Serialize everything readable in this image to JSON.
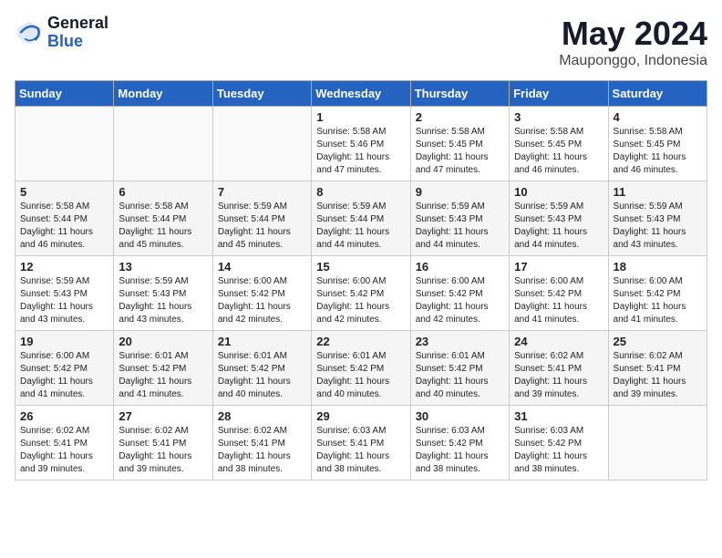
{
  "header": {
    "logo_general": "General",
    "logo_blue": "Blue",
    "month_year": "May 2024",
    "location": "Mauponggo, Indonesia"
  },
  "weekdays": [
    "Sunday",
    "Monday",
    "Tuesday",
    "Wednesday",
    "Thursday",
    "Friday",
    "Saturday"
  ],
  "weeks": [
    [
      {
        "day": "",
        "info": ""
      },
      {
        "day": "",
        "info": ""
      },
      {
        "day": "",
        "info": ""
      },
      {
        "day": "1",
        "info": "Sunrise: 5:58 AM\nSunset: 5:46 PM\nDaylight: 11 hours\nand 47 minutes."
      },
      {
        "day": "2",
        "info": "Sunrise: 5:58 AM\nSunset: 5:45 PM\nDaylight: 11 hours\nand 47 minutes."
      },
      {
        "day": "3",
        "info": "Sunrise: 5:58 AM\nSunset: 5:45 PM\nDaylight: 11 hours\nand 46 minutes."
      },
      {
        "day": "4",
        "info": "Sunrise: 5:58 AM\nSunset: 5:45 PM\nDaylight: 11 hours\nand 46 minutes."
      }
    ],
    [
      {
        "day": "5",
        "info": "Sunrise: 5:58 AM\nSunset: 5:44 PM\nDaylight: 11 hours\nand 46 minutes."
      },
      {
        "day": "6",
        "info": "Sunrise: 5:58 AM\nSunset: 5:44 PM\nDaylight: 11 hours\nand 45 minutes."
      },
      {
        "day": "7",
        "info": "Sunrise: 5:59 AM\nSunset: 5:44 PM\nDaylight: 11 hours\nand 45 minutes."
      },
      {
        "day": "8",
        "info": "Sunrise: 5:59 AM\nSunset: 5:44 PM\nDaylight: 11 hours\nand 44 minutes."
      },
      {
        "day": "9",
        "info": "Sunrise: 5:59 AM\nSunset: 5:43 PM\nDaylight: 11 hours\nand 44 minutes."
      },
      {
        "day": "10",
        "info": "Sunrise: 5:59 AM\nSunset: 5:43 PM\nDaylight: 11 hours\nand 44 minutes."
      },
      {
        "day": "11",
        "info": "Sunrise: 5:59 AM\nSunset: 5:43 PM\nDaylight: 11 hours\nand 43 minutes."
      }
    ],
    [
      {
        "day": "12",
        "info": "Sunrise: 5:59 AM\nSunset: 5:43 PM\nDaylight: 11 hours\nand 43 minutes."
      },
      {
        "day": "13",
        "info": "Sunrise: 5:59 AM\nSunset: 5:43 PM\nDaylight: 11 hours\nand 43 minutes."
      },
      {
        "day": "14",
        "info": "Sunrise: 6:00 AM\nSunset: 5:42 PM\nDaylight: 11 hours\nand 42 minutes."
      },
      {
        "day": "15",
        "info": "Sunrise: 6:00 AM\nSunset: 5:42 PM\nDaylight: 11 hours\nand 42 minutes."
      },
      {
        "day": "16",
        "info": "Sunrise: 6:00 AM\nSunset: 5:42 PM\nDaylight: 11 hours\nand 42 minutes."
      },
      {
        "day": "17",
        "info": "Sunrise: 6:00 AM\nSunset: 5:42 PM\nDaylight: 11 hours\nand 41 minutes."
      },
      {
        "day": "18",
        "info": "Sunrise: 6:00 AM\nSunset: 5:42 PM\nDaylight: 11 hours\nand 41 minutes."
      }
    ],
    [
      {
        "day": "19",
        "info": "Sunrise: 6:00 AM\nSunset: 5:42 PM\nDaylight: 11 hours\nand 41 minutes."
      },
      {
        "day": "20",
        "info": "Sunrise: 6:01 AM\nSunset: 5:42 PM\nDaylight: 11 hours\nand 41 minutes."
      },
      {
        "day": "21",
        "info": "Sunrise: 6:01 AM\nSunset: 5:42 PM\nDaylight: 11 hours\nand 40 minutes."
      },
      {
        "day": "22",
        "info": "Sunrise: 6:01 AM\nSunset: 5:42 PM\nDaylight: 11 hours\nand 40 minutes."
      },
      {
        "day": "23",
        "info": "Sunrise: 6:01 AM\nSunset: 5:42 PM\nDaylight: 11 hours\nand 40 minutes."
      },
      {
        "day": "24",
        "info": "Sunrise: 6:02 AM\nSunset: 5:41 PM\nDaylight: 11 hours\nand 39 minutes."
      },
      {
        "day": "25",
        "info": "Sunrise: 6:02 AM\nSunset: 5:41 PM\nDaylight: 11 hours\nand 39 minutes."
      }
    ],
    [
      {
        "day": "26",
        "info": "Sunrise: 6:02 AM\nSunset: 5:41 PM\nDaylight: 11 hours\nand 39 minutes."
      },
      {
        "day": "27",
        "info": "Sunrise: 6:02 AM\nSunset: 5:41 PM\nDaylight: 11 hours\nand 39 minutes."
      },
      {
        "day": "28",
        "info": "Sunrise: 6:02 AM\nSunset: 5:41 PM\nDaylight: 11 hours\nand 38 minutes."
      },
      {
        "day": "29",
        "info": "Sunrise: 6:03 AM\nSunset: 5:41 PM\nDaylight: 11 hours\nand 38 minutes."
      },
      {
        "day": "30",
        "info": "Sunrise: 6:03 AM\nSunset: 5:42 PM\nDaylight: 11 hours\nand 38 minutes."
      },
      {
        "day": "31",
        "info": "Sunrise: 6:03 AM\nSunset: 5:42 PM\nDaylight: 11 hours\nand 38 minutes."
      },
      {
        "day": "",
        "info": ""
      }
    ]
  ]
}
